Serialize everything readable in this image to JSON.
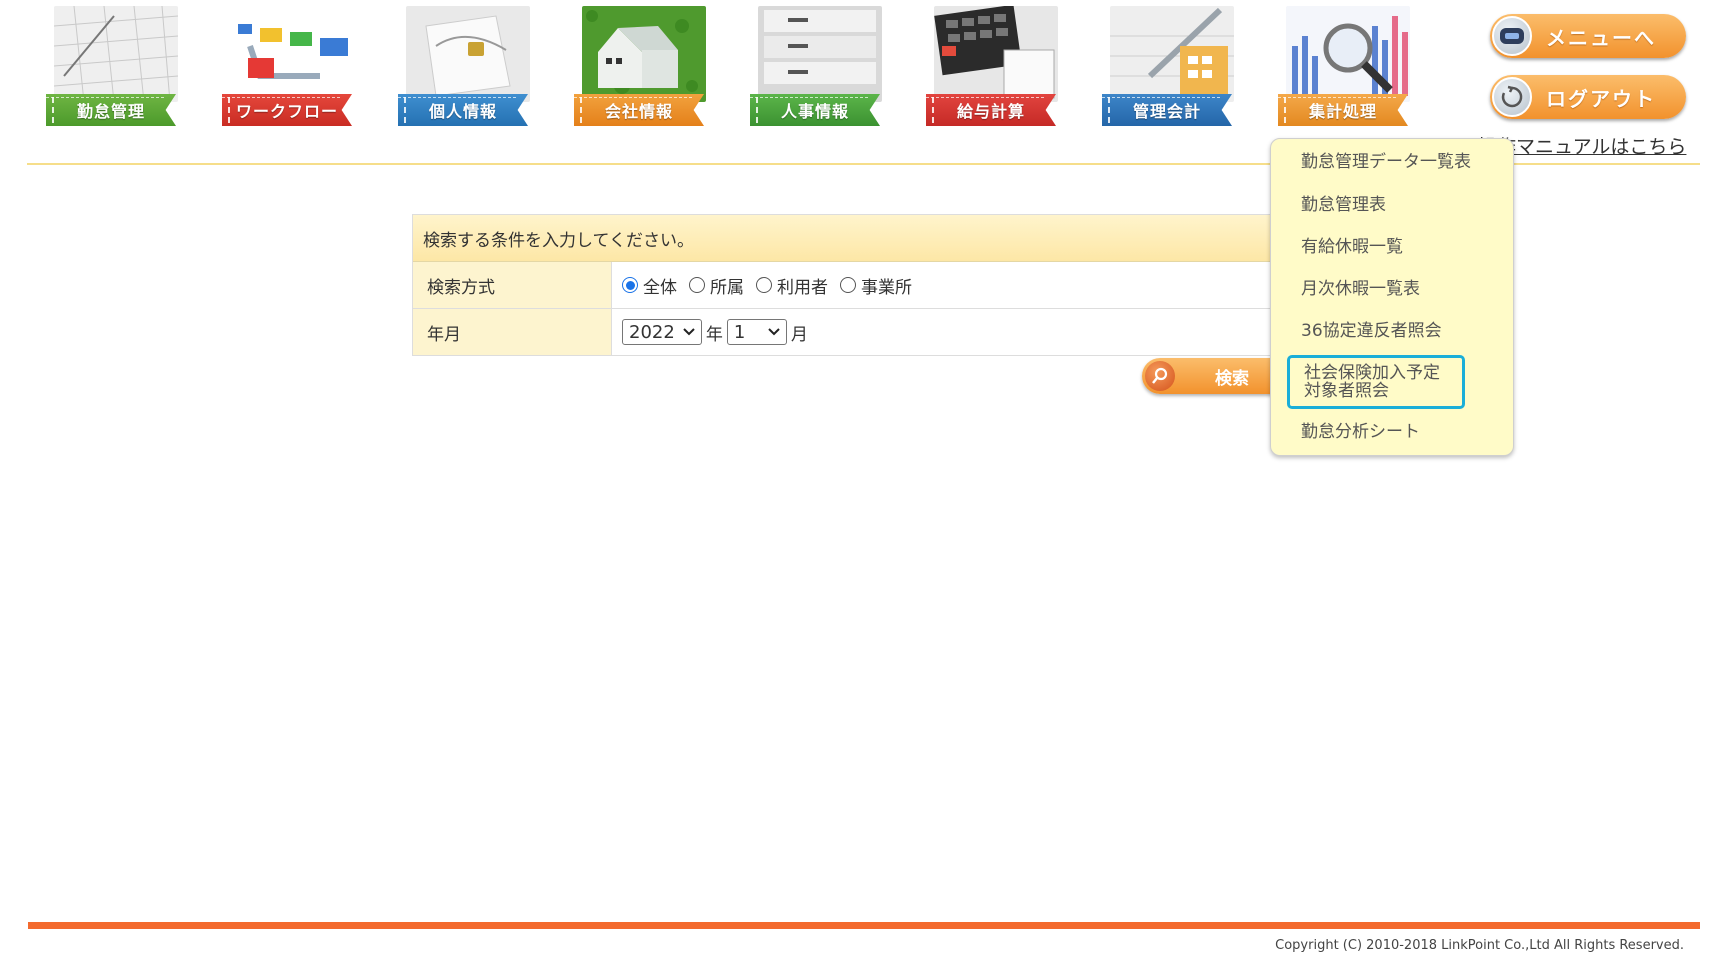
{
  "nav": {
    "items": [
      {
        "label": "勤怠管理",
        "icon": "calendar-icon"
      },
      {
        "label": "ワークフロー",
        "icon": "workflow-icon"
      },
      {
        "label": "個人情報",
        "icon": "lock-folder-icon"
      },
      {
        "label": "会社情報",
        "icon": "house-icon"
      },
      {
        "label": "人事情報",
        "icon": "file-cabinet-icon"
      },
      {
        "label": "給与計算",
        "icon": "calculator-icon"
      },
      {
        "label": "管理会計",
        "icon": "pen-ledger-icon"
      },
      {
        "label": "集計処理",
        "icon": "magnifier-chart-icon"
      }
    ]
  },
  "header": {
    "menu_button": "メニューへ",
    "logout_button": "ログアウト",
    "manual_link": "操作マニュアルはこちら"
  },
  "search": {
    "heading": "検索する条件を入力してください。",
    "method_label": "検索方式",
    "method_options": [
      "全体",
      "所属",
      "利用者",
      "事業所"
    ],
    "method_selected": "全体",
    "yearmonth_label": "年月",
    "year_value": "2022",
    "year_unit": "年",
    "month_value": "1",
    "month_unit": "月",
    "button_label": "検索"
  },
  "dropdown": {
    "items": [
      "勤怠管理データ一覧表",
      "勤怠管理表",
      "有給休暇一覧",
      "月次休暇一覧表",
      "36協定違反者照会",
      "社会保険加入予定対象者照会",
      "勤怠分析シート"
    ],
    "active_line1": "社会保険加入予定",
    "active_line2": "対象者照会"
  },
  "footer": {
    "copyright": "Copyright (C) 2010-2018 LinkPoint Co.,Ltd All Rights Reserved."
  },
  "colors": {
    "accent_orange": "#f36a2e",
    "header_rule": "#f6de8a",
    "dropdown_bg": "#fffbc8",
    "highlight_border": "#1aaed8"
  }
}
